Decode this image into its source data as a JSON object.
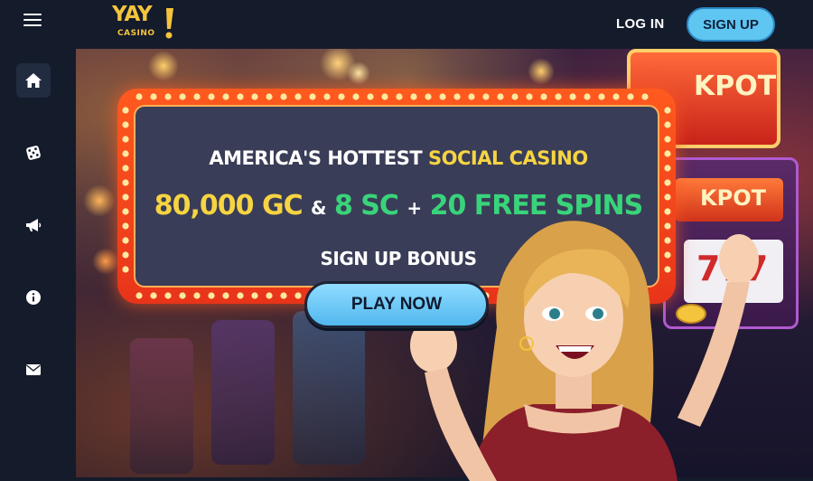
{
  "brand": {
    "logo_main": "YAY",
    "logo_sub": "CASINO"
  },
  "header": {
    "login_label": "LOG IN",
    "signup_label": "SIGN UP"
  },
  "sidebar": {
    "items": [
      {
        "name": "home",
        "icon": "home-icon",
        "active": true
      },
      {
        "name": "games",
        "icon": "dice-icon",
        "active": false
      },
      {
        "name": "promotions",
        "icon": "megaphone-icon",
        "active": false
      },
      {
        "name": "info",
        "icon": "info-icon",
        "active": false
      },
      {
        "name": "contact",
        "icon": "mail-icon",
        "active": false
      }
    ]
  },
  "banner": {
    "headline_prefix": "AMERICA'S HOTTEST",
    "headline_highlight": "SOCIAL CASINO",
    "offer_gc": "80,000 GC",
    "offer_amp": "&",
    "offer_sc": "8 SC",
    "offer_plus": "+",
    "offer_spins": "20 FREE SPINS",
    "bonus_text": "SIGN UP BONUS",
    "cta_label": "PLAY NOW",
    "sign_text_1": "KPOT",
    "sign_text_2": "KPOT",
    "sign_text_3": "777"
  },
  "colors": {
    "background": "#141b2b",
    "accent_blue": "#5fc6f2",
    "brand_yellow": "#f4c43c",
    "offer_green": "#39d47a",
    "marquee_orange": "#ff5a1e"
  }
}
